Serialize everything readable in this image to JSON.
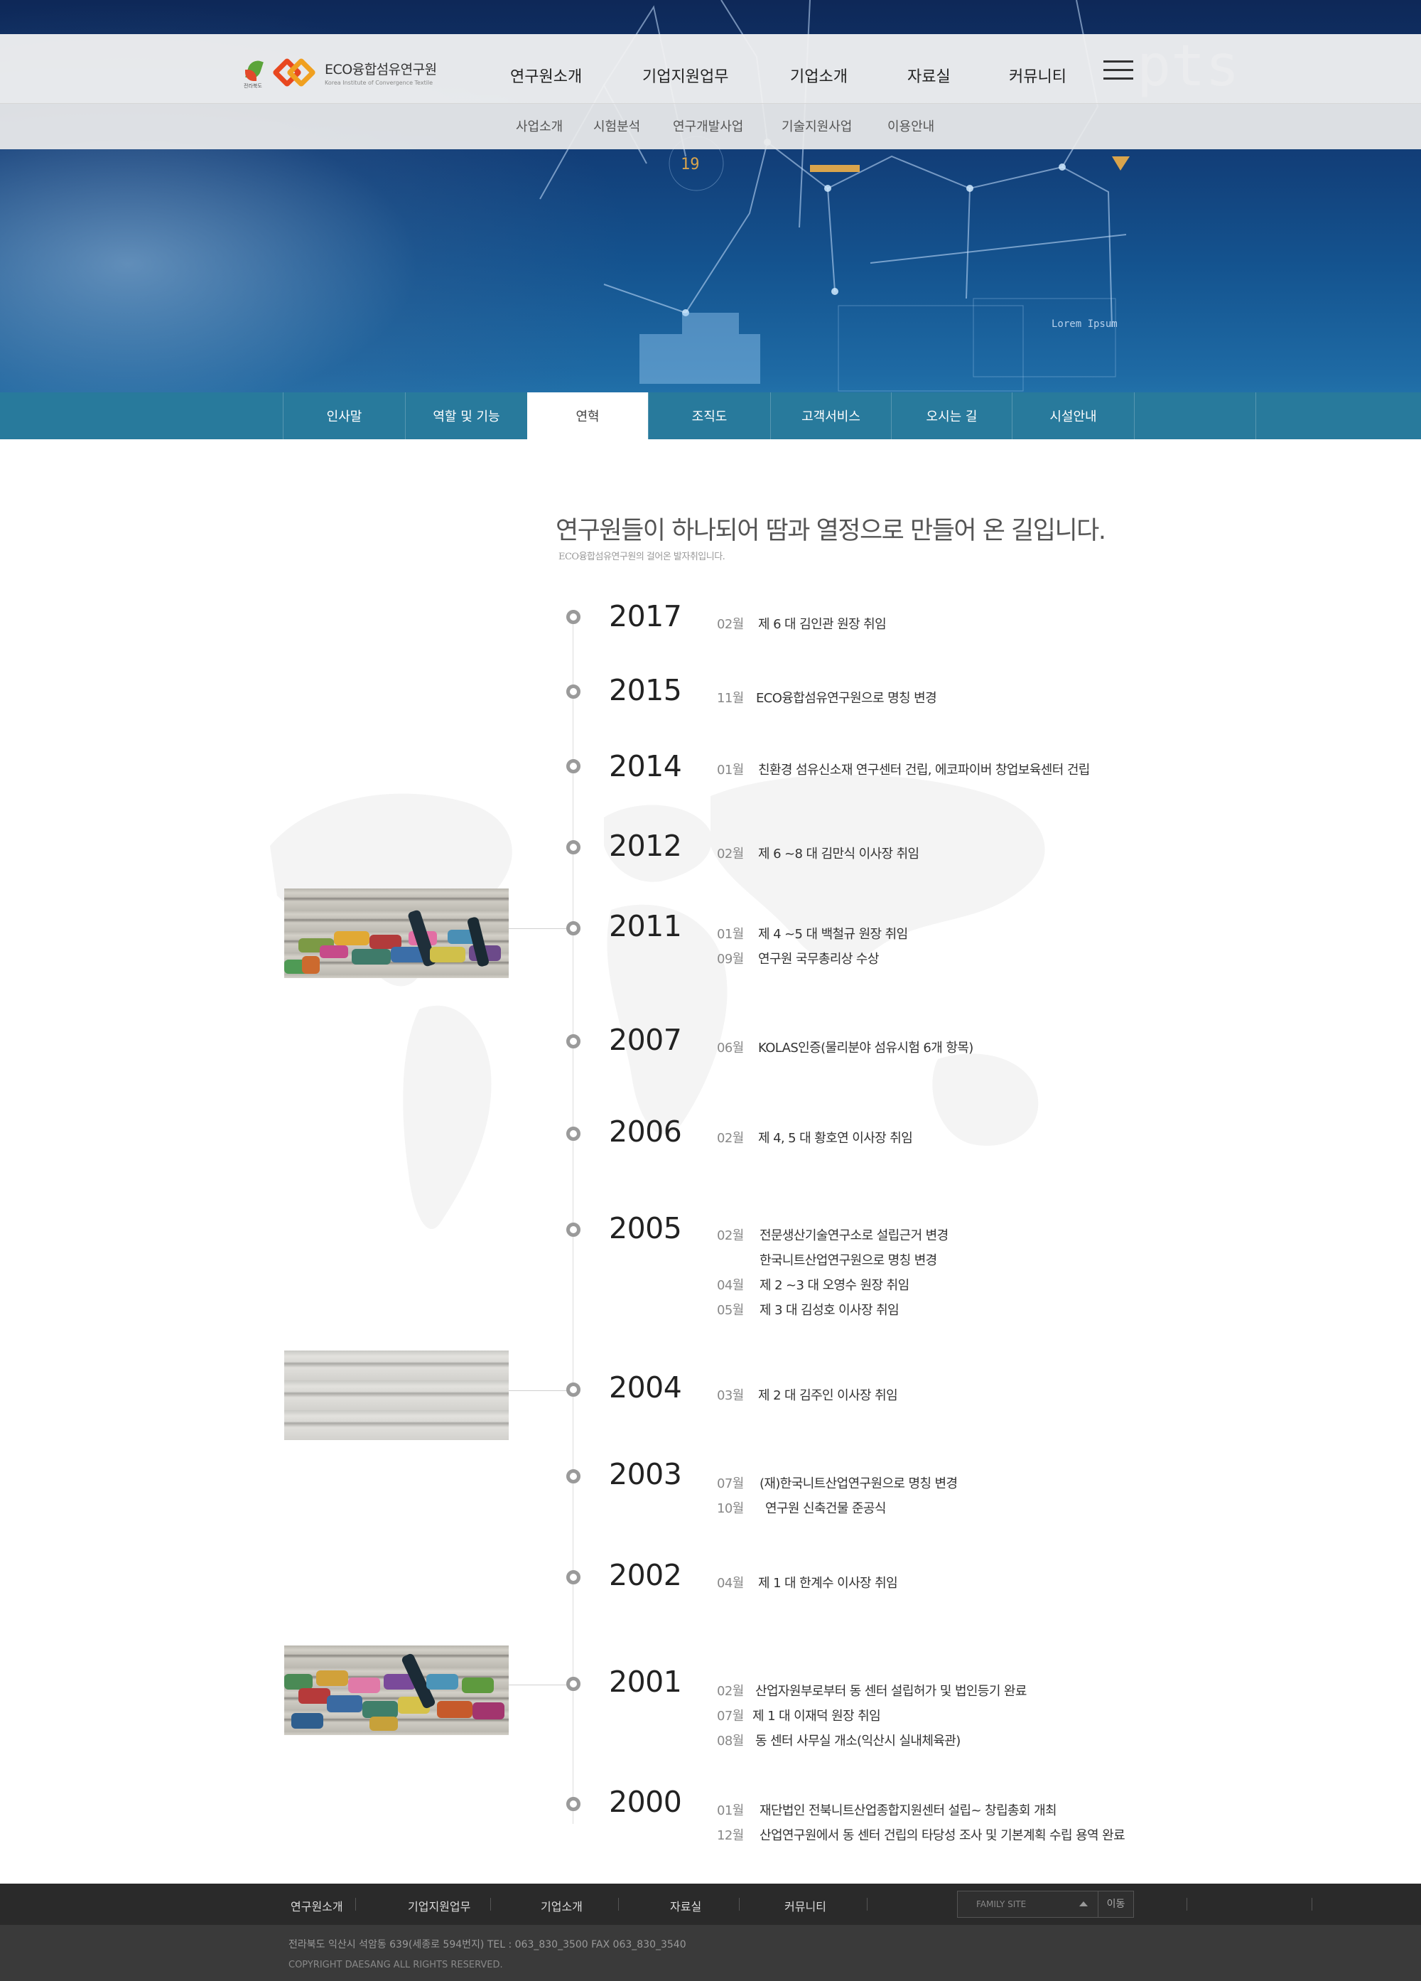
{
  "header": {
    "logo": {
      "region_caption": "전라북도",
      "name": "ECO융합섬유연구원",
      "subtitle": "Korea Institute of Convergence Textile"
    },
    "gnb": [
      "연구원소개",
      "기업지원업무",
      "기업소개",
      "자료실",
      "커뮤니티"
    ],
    "lnb": [
      "사업소개",
      "시험분석",
      "연구개발사업",
      "기술지원사업",
      "이용안내"
    ]
  },
  "hero": {
    "overlay_number": "19",
    "overlay_text": "pts",
    "overlay_label": "Lorem Ipsum"
  },
  "tabs": [
    "인사말",
    "역할 및 기능",
    "연혁",
    "조직도",
    "고객서비스",
    "오시는 길",
    "시설안내"
  ],
  "active_tab": "연혁",
  "content": {
    "headline": "연구원들이 하나되어 땀과 열정으로 만들어 온 길입니다.",
    "subline": "ECO융합섬유연구원의 걸어온 발자취입니다."
  },
  "history": [
    {
      "year": "2017",
      "events": [
        {
          "month": "02월",
          "text": "제 6 대 김인관 원장 취임"
        }
      ]
    },
    {
      "year": "2015",
      "events": [
        {
          "month": "11월",
          "text": "ECO융합섬유연구원으로 명칭 변경"
        }
      ]
    },
    {
      "year": "2014",
      "events": [
        {
          "month": "01월",
          "text": "친환경 섬유신소재 연구센터 건립, 에코파이버 창업보육센터 건립"
        }
      ]
    },
    {
      "year": "2012",
      "events": [
        {
          "month": "02월",
          "text": "제 6 ~8 대 김만식 이사장 취임"
        }
      ]
    },
    {
      "year": "2011",
      "events": [
        {
          "month": "01월",
          "text": "제 4 ~5 대 백철규 원장 취임"
        },
        {
          "month": "09월",
          "text": "연구원 국무총리상 수상"
        }
      ]
    },
    {
      "year": "2007",
      "events": [
        {
          "month": "06월",
          "text": "KOLAS인증(물리분야 섬유시험 6개 항목)"
        }
      ]
    },
    {
      "year": "2006",
      "events": [
        {
          "month": "02월",
          "text": "제 4, 5 대 황호연 이사장 취임"
        }
      ]
    },
    {
      "year": "2005",
      "events": [
        {
          "month": "02월",
          "text": "전문생산기술연구소로 설립근거 변경"
        },
        {
          "month": "",
          "text": "한국니트산업연구원으로 명칭 변경"
        },
        {
          "month": "04월",
          "text": "제 2 ~3 대 오영수 원장 취임"
        },
        {
          "month": "05월",
          "text": "제 3 대 김성호 이사장 취임"
        }
      ]
    },
    {
      "year": "2004",
      "events": [
        {
          "month": "03월",
          "text": "제 2 대 김주인 이사장 취임"
        }
      ]
    },
    {
      "year": "2003",
      "events": [
        {
          "month": "07월",
          "text": "(재)한국니트산업연구원으로 명칭 변경"
        },
        {
          "month": "10월",
          "text": "연구원 신축건물 준공식"
        }
      ]
    },
    {
      "year": "2002",
      "events": [
        {
          "month": "04월",
          "text": "제 1 대 한계수 이사장 취임"
        }
      ]
    },
    {
      "year": "2001",
      "events": [
        {
          "month": "02월",
          "text": "산업자원부로부터 동 센터 설립허가 및 법인등기 완료"
        },
        {
          "month": "07월",
          "text": "제 1 대 이재덕 원장 취임"
        },
        {
          "month": "08월",
          "text": "동 센터 사무실 개소(익산시 실내체육관)"
        }
      ]
    },
    {
      "year": "2000",
      "events": [
        {
          "month": "01월",
          "text": "재단법인 전북니트산업종합지원센터 설립~ 창립총회 개최"
        },
        {
          "month": "12월",
          "text": "산업연구원에서 동 센터 건립의 타당성 조사 및 기본계획 수립 용역 완료"
        }
      ]
    }
  ],
  "footer": {
    "nav": [
      "연구원소개",
      "기업지원업무",
      "기업소개",
      "자료실",
      "커뮤니티"
    ],
    "family_site": "FAMILY SITE",
    "go_label": "이동",
    "address": "전라북도 익산시 석암동 639(세종로 594번지)   TEL : 063_830_3500    FAX  063_830_3540",
    "copyright": "COPYRIGHT DAESANG ALL RIGHTS RESERVED."
  }
}
